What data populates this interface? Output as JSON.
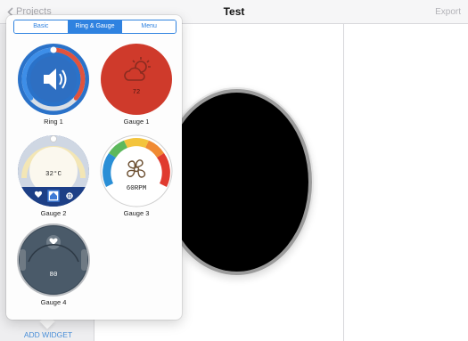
{
  "header": {
    "back_label": "Projects",
    "title": "Test",
    "export_label": "Export"
  },
  "tabs": [
    {
      "label": "Basic",
      "active": false
    },
    {
      "label": "Ring & Gauge",
      "active": true
    },
    {
      "label": "Menu",
      "active": false
    }
  ],
  "widgets": {
    "ring1": {
      "label": "Ring 1",
      "icon": "speaker-icon"
    },
    "gauge1": {
      "label": "Gauge 1",
      "value": "72",
      "icon": "cloud-sun-icon"
    },
    "gauge2": {
      "label": "Gauge 2",
      "value": "32°C",
      "icons": [
        "heart-icon",
        "home-icon",
        "fan-icon"
      ]
    },
    "gauge3": {
      "label": "Gauge 3",
      "value": "60RPM",
      "icon": "fan-icon"
    },
    "gauge4": {
      "label": "Gauge 4",
      "value": "80",
      "icon": "heart-icon"
    }
  },
  "footer": {
    "add_widget_label": "ADD WIDGET"
  },
  "colors": {
    "accent": "#2f82e0",
    "ring_blue": "#2a72c9",
    "ring_red": "#e1533d",
    "gauge1_red": "#cf3a2b",
    "gauge2_navy": "#1d3f86",
    "gauge4_slate": "#3c4b59",
    "preview_fill": "#000000"
  }
}
